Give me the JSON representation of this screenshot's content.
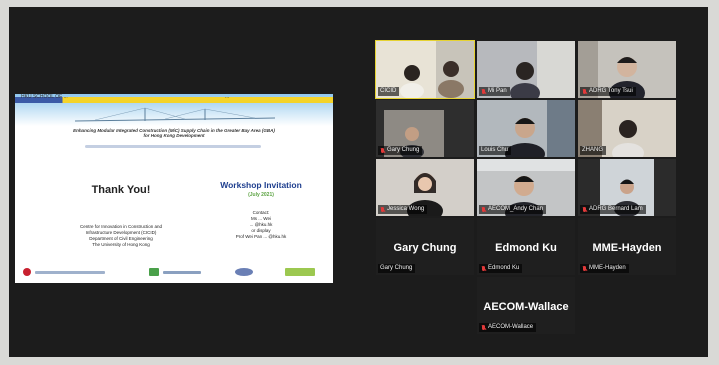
{
  "slide": {
    "header_left": "HKU SCHOOL OF ...",
    "header_right": "...",
    "title_line1": "Enhancing Modular Integrated Construction (MiC) Supply Chain in the Greater Bay Area (GBA)",
    "title_line2": "for Hong Kong Development",
    "thank_you": "Thank You!",
    "centre_lines": [
      "Centre for Innovation in Construction and",
      "Infrastructure Development (CICID)",
      "Department of Civil Engineering",
      "The University of Hong Kong"
    ],
    "workshop_title": "Workshop Invitation",
    "workshop_sub": "(July 2021)",
    "contact_lines": [
      "Contact:",
      "Ms ... Wei",
      "... @hku.hk",
      "or display",
      "Prof Wei Pan ... @hku.hk"
    ]
  },
  "participants": [
    {
      "name": "CICID",
      "muted": false,
      "video": true,
      "active": true
    },
    {
      "name": "Mi Pan",
      "muted": true,
      "video": true
    },
    {
      "name": "ADRG Tony Tsui",
      "muted": true,
      "video": true
    },
    {
      "name": "Gary Chung",
      "muted": true,
      "video": true
    },
    {
      "name": "Louis Chu",
      "muted": true,
      "video": true
    },
    {
      "name": "ZHANG",
      "muted": false,
      "video": true
    },
    {
      "name": "Jessica Wong",
      "muted": true,
      "video": true
    },
    {
      "name": "AECOM_Andy Chan",
      "muted": true,
      "video": true
    },
    {
      "name": "ADRG Bernard Lam",
      "muted": true,
      "video": true
    },
    {
      "name": "Gary Chung",
      "label": "Gary Chung",
      "muted": false,
      "video": false
    },
    {
      "name": "Edmond Ku",
      "label": "Edmond Ku",
      "muted": true,
      "video": false
    },
    {
      "name": "MME-Hayden",
      "label": "MME-Hayden",
      "muted": true,
      "video": false
    },
    {
      "name": "AECOM-Wallace",
      "label": "AECOM-Wallace",
      "muted": true,
      "video": false
    }
  ],
  "colors": {
    "active_border": "#e5d232",
    "mute_icon": "#e23a3a",
    "workshop_blue": "#1f3f8f",
    "workshop_green": "#5ca342"
  }
}
